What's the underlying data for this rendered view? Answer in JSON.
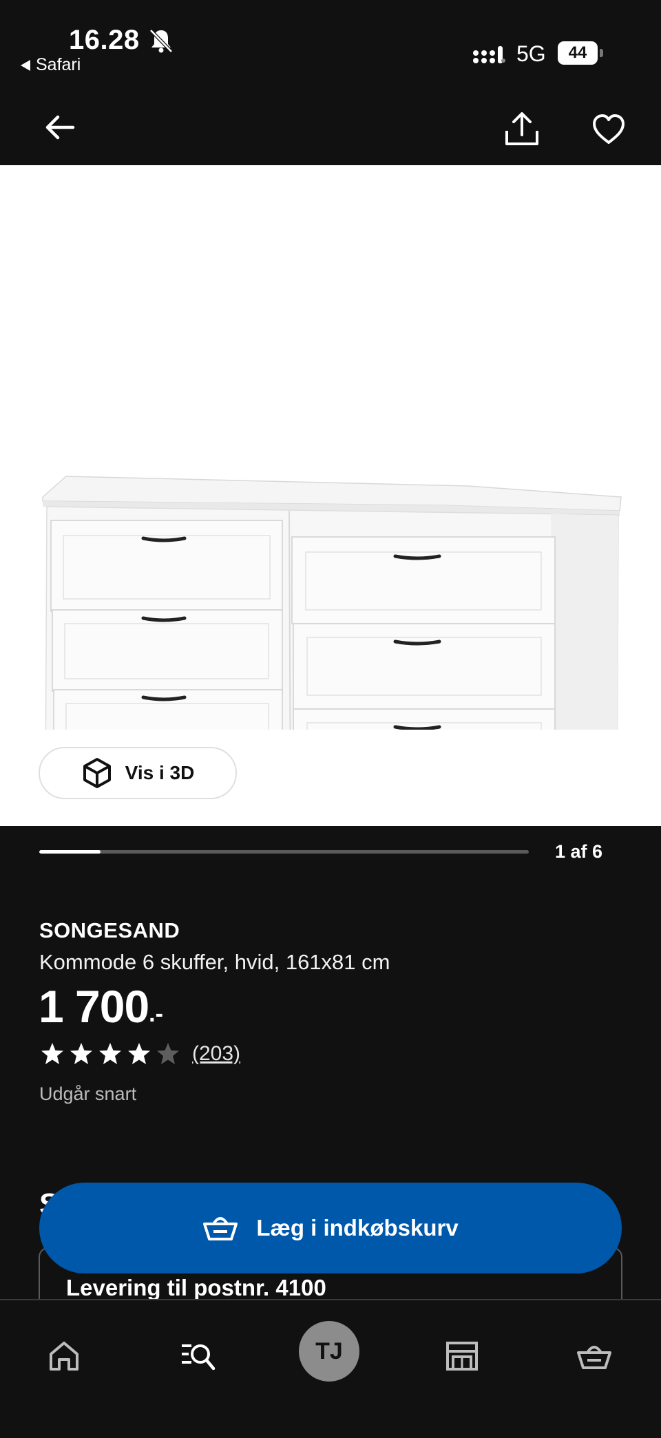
{
  "status_bar": {
    "time": "16.28",
    "back_app": "Safari",
    "network": "5G",
    "battery": "44"
  },
  "gallery": {
    "view_3d_label": "Vis i 3D",
    "counter": "1 af 6",
    "progress_fraction": 0.125
  },
  "product": {
    "name": "SONGESAND",
    "description": "Kommode 6 skuffer, hvid, 161x81 cm",
    "price_main": "1 700",
    "price_suffix": ".-",
    "rating_stars": 4,
    "rating_max": 5,
    "review_count": "(203)",
    "status": "Udgår snart"
  },
  "below_fold": {
    "section_heading_partial": "S",
    "delivery_text": "Levering til postnr. 4100"
  },
  "cart_button": {
    "label": "Læg i indkøbskurv"
  },
  "tab_bar": {
    "profile_initials": "TJ"
  },
  "colors": {
    "accent": "#0058ab",
    "background": "#111111"
  }
}
